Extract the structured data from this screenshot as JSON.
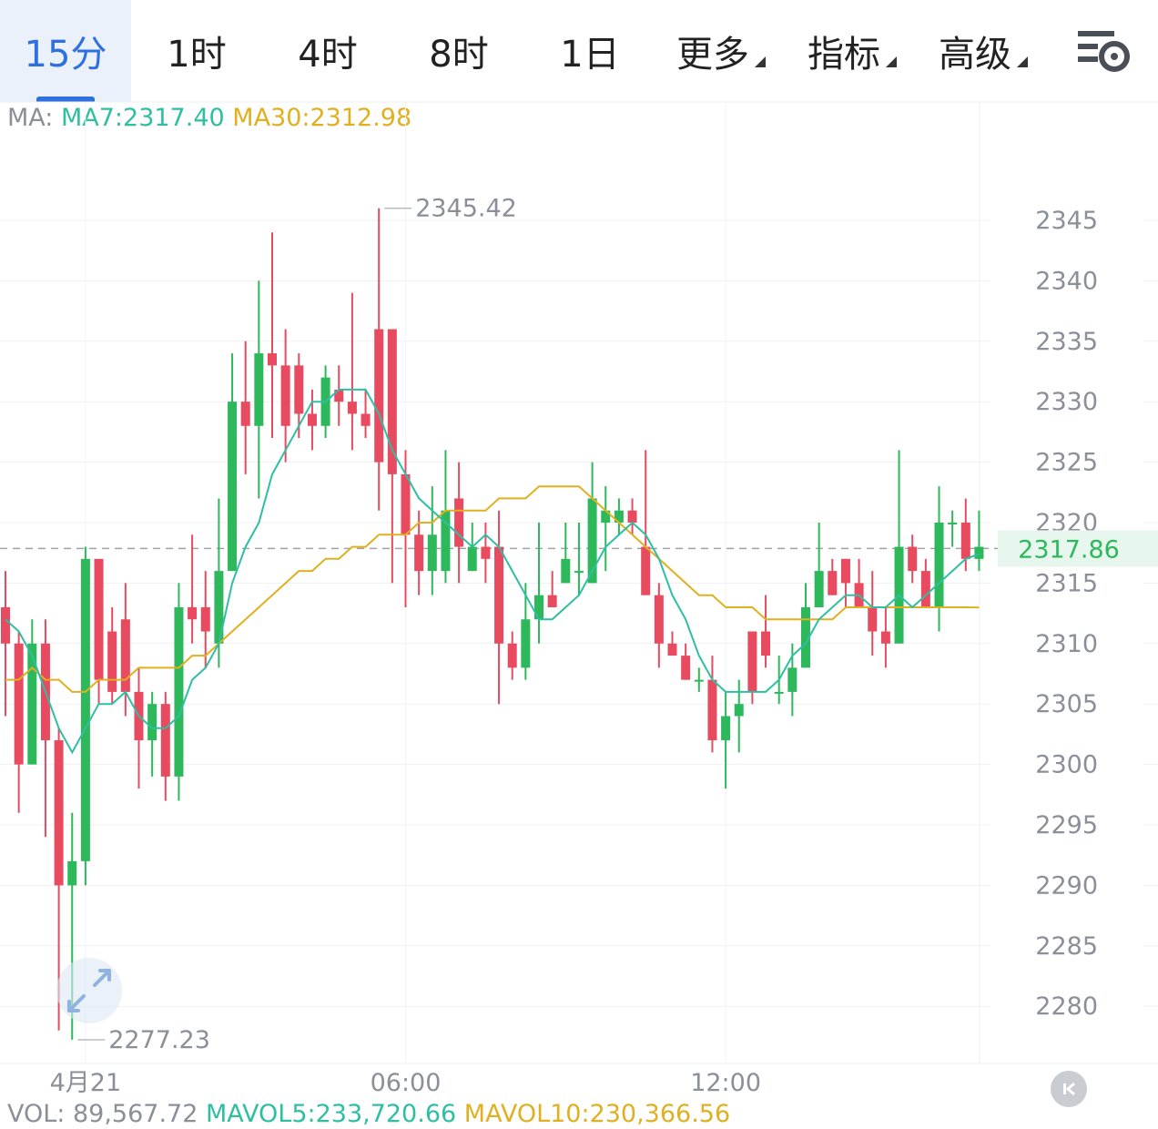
{
  "tabs": [
    {
      "label": "15分",
      "active": true,
      "dropdown": false
    },
    {
      "label": "1时",
      "active": false,
      "dropdown": false
    },
    {
      "label": "4时",
      "active": false,
      "dropdown": false
    },
    {
      "label": "8时",
      "active": false,
      "dropdown": false
    },
    {
      "label": "1日",
      "active": false,
      "dropdown": false
    },
    {
      "label": "更多",
      "active": false,
      "dropdown": true
    },
    {
      "label": "指标",
      "active": false,
      "dropdown": true
    },
    {
      "label": "高级",
      "active": false,
      "dropdown": true
    }
  ],
  "ma_legend": {
    "prefix": "MA:",
    "ma7": "MA7:2317.40",
    "ma30": "MA30:2312.98"
  },
  "vol_legend": {
    "prefix": "VOL: 89,567.72",
    "mavol5": "MAVOL5:233,720.66",
    "mavol10": "MAVOL10:230,366.56"
  },
  "colors": {
    "up": "#2eb85c",
    "down": "#e84a5f",
    "ma7": "#2ebfa3",
    "ma30": "#e0b020",
    "accent": "#2f6fe0"
  },
  "icons": {
    "settings": "chart-settings-icon",
    "expand": "expand-arrows-icon",
    "back": "jump-to-latest-icon"
  },
  "chart_data": {
    "type": "candlestick",
    "y_ticks": [
      2345,
      2340,
      2335,
      2330,
      2325,
      2320,
      2315,
      2310,
      2305,
      2300,
      2295,
      2290,
      2285,
      2280
    ],
    "x_ticks": [
      {
        "label": "4月21",
        "index": 6
      },
      {
        "label": "06:00",
        "index": 30
      },
      {
        "label": "12:00",
        "index": 54
      }
    ],
    "current_price": "2317.86",
    "high_label": "2345.42",
    "low_label": "2277.23",
    "candles": [
      [
        2313,
        2310,
        2316,
        2304
      ],
      [
        2310,
        2300,
        2311,
        2296
      ],
      [
        2300,
        2310,
        2312,
        2300
      ],
      [
        2310,
        2302,
        2312,
        2294
      ],
      [
        2302,
        2290,
        2303,
        2278
      ],
      [
        2290,
        2292,
        2296,
        2277.23
      ],
      [
        2292,
        2317,
        2318,
        2290
      ],
      [
        2317,
        2307,
        2317,
        2305
      ],
      [
        2311,
        2306,
        2313,
        2305
      ],
      [
        2312,
        2306,
        2315,
        2304
      ],
      [
        2306,
        2302,
        2308,
        2298
      ],
      [
        2302,
        2305,
        2306,
        2299
      ],
      [
        2305,
        2299,
        2306,
        2297
      ],
      [
        2299,
        2313,
        2315,
        2297
      ],
      [
        2313,
        2312,
        2319,
        2310
      ],
      [
        2313,
        2311,
        2316,
        2308
      ],
      [
        2310,
        2316,
        2322,
        2308
      ],
      [
        2316,
        2330,
        2334,
        2316
      ],
      [
        2330,
        2328,
        2335,
        2324
      ],
      [
        2328,
        2334,
        2340,
        2322
      ],
      [
        2334,
        2333,
        2344,
        2327
      ],
      [
        2333,
        2328,
        2336,
        2325
      ],
      [
        2333,
        2329,
        2334,
        2327
      ],
      [
        2329,
        2328,
        2331,
        2326
      ],
      [
        2328,
        2332,
        2333,
        2327
      ],
      [
        2331,
        2330,
        2333,
        2328
      ],
      [
        2330,
        2329,
        2339,
        2326
      ],
      [
        2329,
        2328,
        2331,
        2327
      ],
      [
        2336,
        2325,
        2346,
        2321
      ],
      [
        2336,
        2324,
        2336,
        2315
      ],
      [
        2324,
        2319,
        2326,
        2313
      ],
      [
        2319,
        2316,
        2321,
        2314
      ],
      [
        2316,
        2319,
        2323,
        2314
      ],
      [
        2316,
        2321,
        2326,
        2315
      ],
      [
        2322,
        2318,
        2325,
        2315
      ],
      [
        2316,
        2318,
        2320,
        2316
      ],
      [
        2318,
        2317,
        2320,
        2315
      ],
      [
        2318,
        2310,
        2321,
        2305
      ],
      [
        2310,
        2308,
        2311,
        2307
      ],
      [
        2308,
        2312,
        2315,
        2307
      ],
      [
        2312,
        2314,
        2320,
        2310
      ],
      [
        2314,
        2313,
        2316,
        2313
      ],
      [
        2315,
        2317,
        2320,
        2316
      ],
      [
        2316,
        2316,
        2320,
        2314
      ],
      [
        2315,
        2322,
        2325,
        2315
      ],
      [
        2320,
        2321,
        2323,
        2316
      ],
      [
        2320,
        2321,
        2322,
        2319
      ],
      [
        2321,
        2320,
        2322,
        2319
      ],
      [
        2318,
        2314,
        2326,
        2314
      ],
      [
        2314,
        2310,
        2315,
        2308
      ],
      [
        2310,
        2309,
        2311,
        2309
      ],
      [
        2309,
        2307,
        2310,
        2307
      ],
      [
        2307,
        2307,
        2308,
        2306
      ],
      [
        2307,
        2302,
        2309,
        2301
      ],
      [
        2302,
        2304,
        2306,
        2298
      ],
      [
        2304,
        2305,
        2307,
        2301
      ],
      [
        2311,
        2306,
        2311,
        2305
      ],
      [
        2311,
        2309,
        2314,
        2308
      ],
      [
        2306,
        2306,
        2309,
        2305
      ],
      [
        2306,
        2308,
        2310,
        2304
      ],
      [
        2308,
        2313,
        2315,
        2308
      ],
      [
        2313,
        2316,
        2320,
        2313
      ],
      [
        2316,
        2314,
        2317,
        2314
      ],
      [
        2317,
        2315,
        2317,
        2313
      ],
      [
        2315,
        2313,
        2317,
        2313
      ],
      [
        2313,
        2311,
        2316,
        2309
      ],
      [
        2311,
        2310,
        2313,
        2308
      ],
      [
        2310,
        2318,
        2326,
        2310
      ],
      [
        2318,
        2316,
        2319,
        2315
      ],
      [
        2316,
        2313,
        2317,
        2313
      ],
      [
        2313,
        2320,
        2323,
        2311
      ],
      [
        2320,
        2320,
        2321,
        2318
      ],
      [
        2320,
        2317,
        2322,
        2316
      ],
      [
        2317,
        2318,
        2321,
        2316
      ]
    ],
    "ma7": [
      2312,
      2311,
      2309,
      2306,
      2303,
      2301,
      2303,
      2305,
      2305,
      2306,
      2304,
      2303,
      2303,
      2304,
      2307,
      2308,
      2310,
      2315,
      2318,
      2320,
      2324,
      2326,
      2328,
      2330,
      2330,
      2331,
      2331,
      2331,
      2329,
      2326,
      2324,
      2322,
      2321,
      2320,
      2319,
      2318,
      2319,
      2318,
      2316,
      2314,
      2312,
      2312,
      2313,
      2314,
      2316,
      2318,
      2319,
      2320,
      2319,
      2317,
      2314,
      2312,
      2309,
      2307,
      2306,
      2306,
      2306,
      2306,
      2307,
      2309,
      2310,
      2312,
      2313,
      2314,
      2314,
      2313,
      2313,
      2314,
      2313,
      2314,
      2315,
      2316,
      2317,
      2317.4
    ],
    "ma30": [
      2307,
      2307,
      2308,
      2307,
      2307,
      2306,
      2306,
      2307,
      2307,
      2307,
      2308,
      2308,
      2308,
      2308,
      2309,
      2309,
      2310,
      2311,
      2312,
      2313,
      2314,
      2315,
      2316,
      2316,
      2317,
      2317,
      2318,
      2318,
      2319,
      2319,
      2319,
      2320,
      2320,
      2321,
      2321,
      2321,
      2321,
      2322,
      2322,
      2322,
      2323,
      2323,
      2323,
      2323,
      2322,
      2321,
      2320,
      2319,
      2318,
      2317,
      2316,
      2315,
      2314,
      2314,
      2313,
      2313,
      2313,
      2312,
      2312,
      2312,
      2312,
      2312,
      2312,
      2313,
      2313,
      2313,
      2313,
      2313,
      2313,
      2313,
      2313,
      2313,
      2313,
      2312.98
    ]
  }
}
